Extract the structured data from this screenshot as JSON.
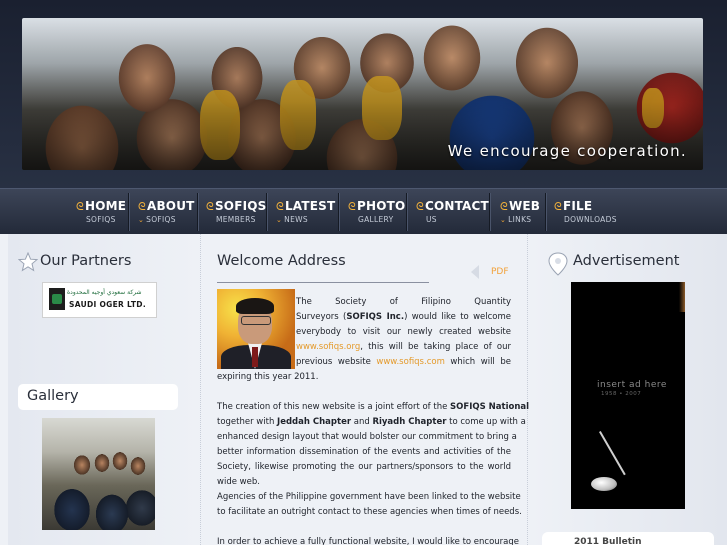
{
  "banner": {
    "tagline": "We encourage cooperation."
  },
  "nav": {
    "items": [
      {
        "label": "HOME",
        "sub": "SOFIQS",
        "icon": "swirl-icon"
      },
      {
        "label": "ABOUT",
        "sub": "SOFIQS",
        "icon": "swirl-icon"
      },
      {
        "label": "SOFIQS",
        "sub": "MEMBERS",
        "icon": "swirl-icon"
      },
      {
        "label": "LATEST",
        "sub": "NEWS",
        "icon": "swirl-icon"
      },
      {
        "label": "PHOTO",
        "sub": "GALLERY",
        "icon": "swirl-icon"
      },
      {
        "label": "CONTACT",
        "sub": "US",
        "icon": "swirl-icon"
      },
      {
        "label": "WEB",
        "sub": "LINKS",
        "icon": "swirl-icon"
      },
      {
        "label": "FILE",
        "sub": "DOWNLOADS",
        "icon": "swirl-icon"
      }
    ]
  },
  "left": {
    "partners_title": "Our Partners",
    "partner_logo_arabic": "شركة سعودي أوجيه المحدودة",
    "partner_logo_name": "SAUDI OGER LTD.",
    "gallery_title": "Gallery"
  },
  "main": {
    "title": "Welcome Address",
    "pdf_label": "PDF",
    "p1": {
      "l1": "The Society of Filipino Quantity",
      "l2a": "Surveyors (",
      "l2b": "SOFIQS Inc.",
      "l2c": ") would like to welcome",
      "l3": "everybody to visit our newly created website",
      "l4a": "www.sofiqs.org",
      "l4b": ", this will be taking place of our",
      "l5a": "previous website ",
      "l5b": "www.sofiqs.com",
      "l5c": " which will be",
      "l6": "expiring this year 2011."
    },
    "p2": {
      "l1a": "The creation of this new website is a joint effort of the ",
      "l1b": "SOFIQS National",
      "l2a": "together with ",
      "l2b": "Jeddah Chapter",
      "l2c": " and ",
      "l2d": "Riyadh Chapter",
      "l2e": " to come up with a",
      "l3": "enhanced design layout that would bolster our commitment to bring a",
      "l4": "better information dissemination of the events and activities of the",
      "l5": "Society, likewise promoting the our partners/sponsors to the world",
      "l6": "wide web.",
      "l7": "Agencies of the Philippine government have been linked to the website",
      "l8": "to facilitate an outright contact to these agencies when times of needs."
    },
    "p3": {
      "l1": "In order to achieve a fully functional website, I would like to encourage"
    }
  },
  "right": {
    "ad_title": "Advertisement",
    "ad_text": "insert ad here",
    "ad_years": "1958 • 2007",
    "box2": "2011 Bulletin"
  },
  "colors": {
    "accent": "#e49a2b",
    "nav_bg": "#2b3242",
    "content_bg": "#eef1f6"
  }
}
